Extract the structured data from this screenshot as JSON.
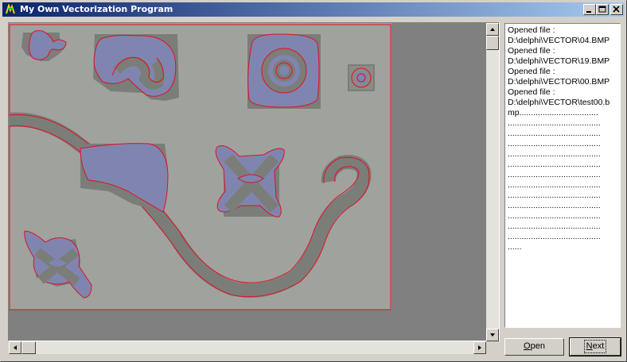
{
  "window": {
    "title": "My Own Vectorization Program",
    "caption_buttons": [
      "minimize-icon",
      "maximize-icon",
      "close-icon"
    ]
  },
  "log": {
    "lines": [
      "Opened file :",
      "D:\\delphi\\VECTOR\\04.BMP",
      "Opened file :",
      "D:\\delphi\\VECTOR\\19.BMP",
      "Opened file :",
      "D:\\delphi\\VECTOR\\00.BMP",
      "Opened file :",
      "D:\\delphi\\VECTOR\\test00.b",
      "mp..................................",
      "........................................",
      "........................................",
      "........................................",
      "........................................",
      "........................................",
      "........................................",
      "........................................",
      "........................................",
      "........................................",
      "........................................",
      "........................................",
      "........................................",
      "......"
    ]
  },
  "buttons": {
    "open": "Open",
    "next": "Next"
  },
  "colors": {
    "canvas_bg": "#a0a29e",
    "blob_fill": "#8085b0",
    "outline": "#e01020",
    "stroke_gray": "#7b7d79"
  }
}
